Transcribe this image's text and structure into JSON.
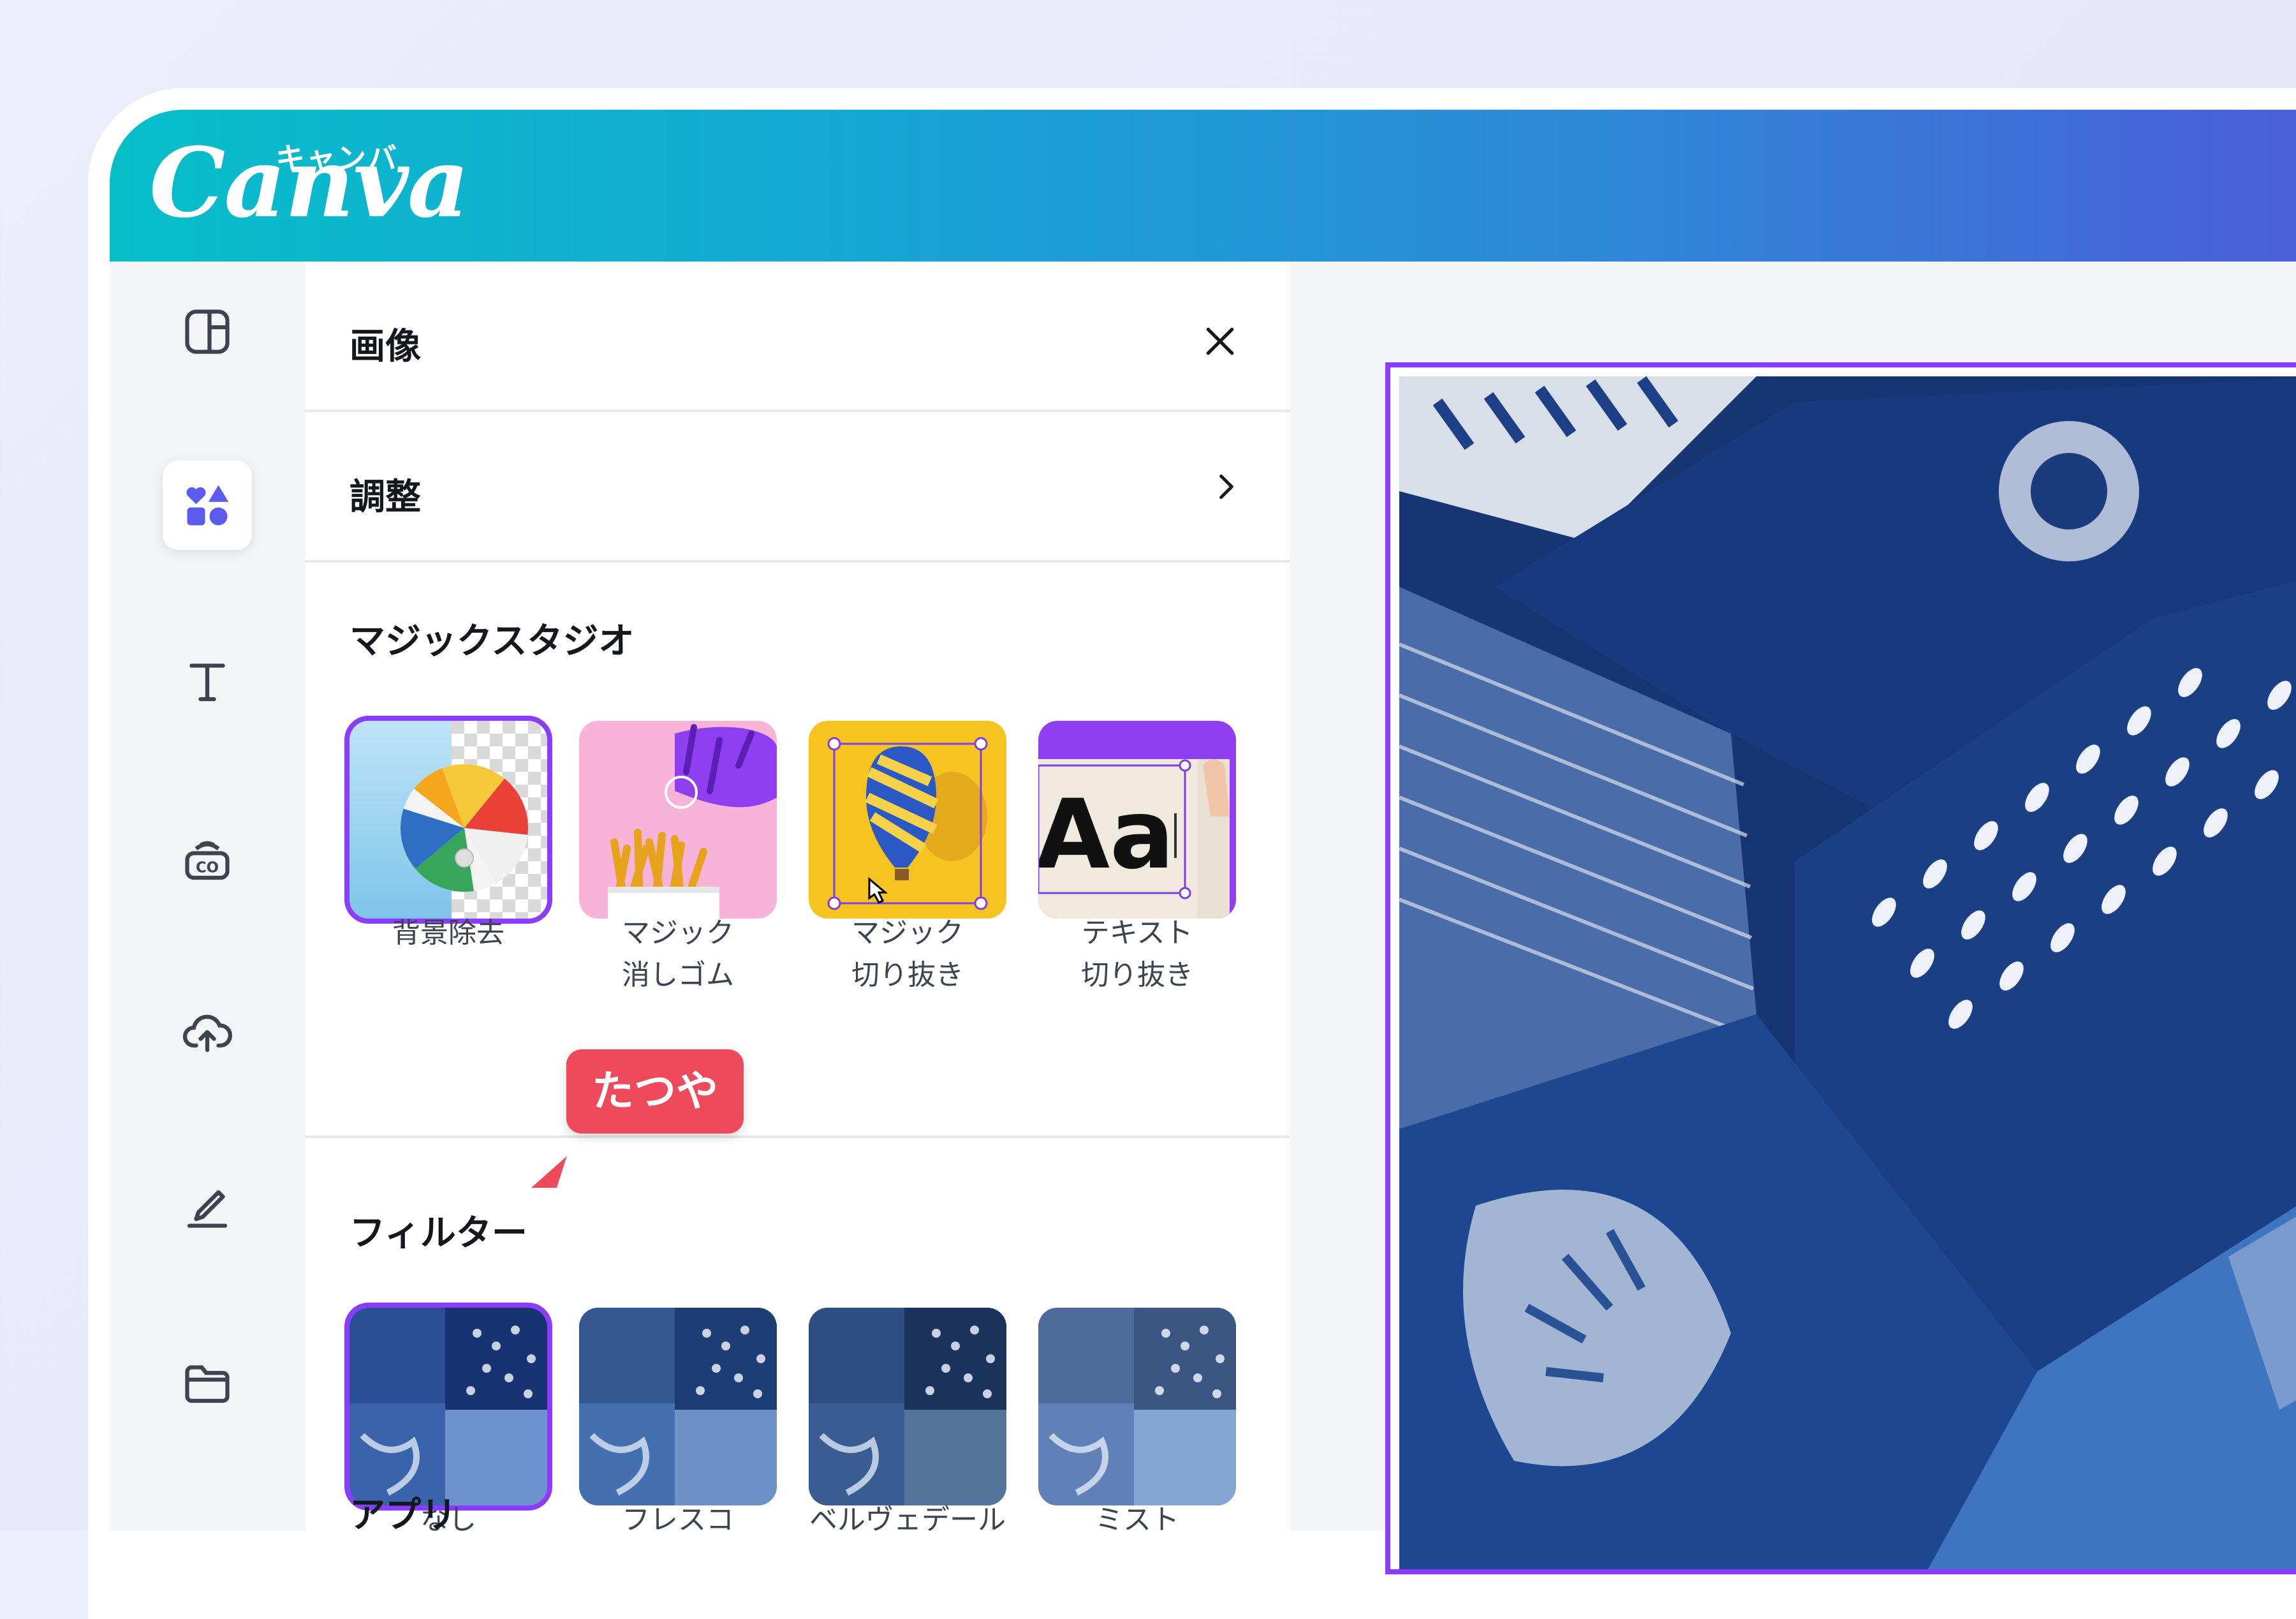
{
  "app": {
    "logo_word": "Canva",
    "logo_kana": "キャンバ"
  },
  "rail": {
    "items": [
      {
        "icon": "layout-icon",
        "active": false
      },
      {
        "icon": "elements-icon",
        "active": true
      },
      {
        "icon": "text-icon",
        "active": false
      },
      {
        "icon": "brand-icon",
        "active": false
      },
      {
        "icon": "upload-cloud-icon",
        "active": false
      },
      {
        "icon": "draw-icon",
        "active": false
      },
      {
        "icon": "folder-icon",
        "active": false
      }
    ]
  },
  "panel": {
    "title": "画像",
    "adjust_label": "調整",
    "magic_studio": {
      "title": "マジックスタジオ",
      "items": [
        {
          "line1": "背景除去",
          "line2": "",
          "selected": true
        },
        {
          "line1": "マジック",
          "line2": "消しゴム",
          "selected": false
        },
        {
          "line1": "マジック",
          "line2": "切り抜き",
          "selected": false
        },
        {
          "line1": "テキスト",
          "line2": "切り抜き",
          "selected": false
        }
      ]
    },
    "filters": {
      "title": "フィルター",
      "items": [
        {
          "label": "なし",
          "selected": true
        },
        {
          "label": "フレスコ",
          "selected": false
        },
        {
          "label": "ベルヴェデール",
          "selected": false
        },
        {
          "label": "ミスト",
          "selected": false
        }
      ]
    },
    "apps": {
      "title": "アプリ"
    }
  },
  "collaborator_tooltip": "たつや",
  "colors": {
    "accent": "#8b3dff",
    "tooltip": "#ee4a5c",
    "header_start": "#07bec9",
    "header_end": "#4a5fd9"
  }
}
